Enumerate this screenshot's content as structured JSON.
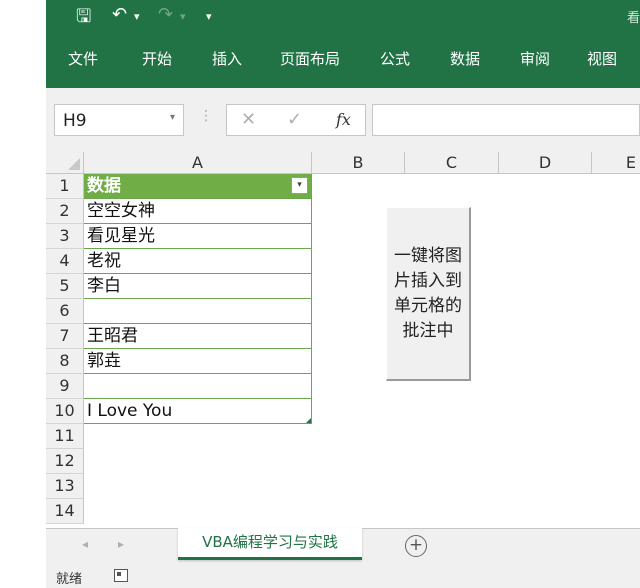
{
  "title_right": "看",
  "quick_access": {
    "save": "🖫",
    "undo": "↶",
    "undo_caret": "▾",
    "redo": "↷",
    "redo_caret": "▾",
    "customize": "▾"
  },
  "ribbon_tabs": [
    "文件",
    "开始",
    "插入",
    "页面布局",
    "公式",
    "数据",
    "审阅",
    "视图"
  ],
  "name_box": {
    "value": "H9",
    "caret": "▾"
  },
  "formula_bar": {
    "dots": "⋮",
    "cancel": "✕",
    "enter": "✓",
    "fx": "fx",
    "value": ""
  },
  "columns": [
    "A",
    "B",
    "C",
    "D",
    "E"
  ],
  "rows": [
    "1",
    "2",
    "3",
    "4",
    "5",
    "6",
    "7",
    "8",
    "9",
    "10",
    "11",
    "12",
    "13",
    "14"
  ],
  "cells_A": [
    "数据",
    "空空女神",
    "看见星光",
    "老祝",
    "李白",
    "",
    "王昭君",
    "郭垚",
    "",
    "I Love You"
  ],
  "filter_arrow": "▾",
  "macro_button": {
    "label": "一键将图片插入到单元格的批注中"
  },
  "sheet_tabs": [
    "VBA编程学习与实践"
  ],
  "sheet_nav": {
    "prev": "◂",
    "next": "▸"
  },
  "add_sheet": "+",
  "status": "就绪",
  "colors": {
    "excel_green": "#217346",
    "table_header": "#70ad47",
    "table_border": "#6aa84f"
  }
}
